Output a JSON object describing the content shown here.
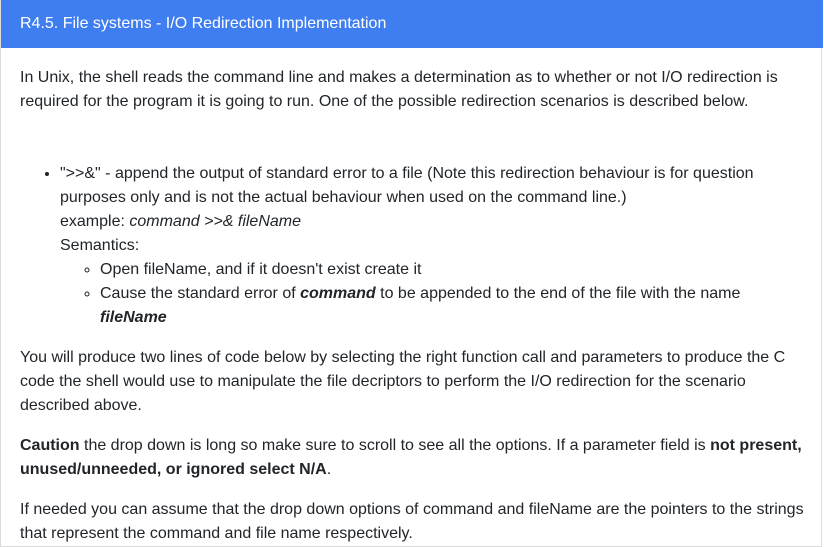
{
  "header": {
    "title": "R4.5. File systems - I/O Redirection Implementation"
  },
  "content": {
    "intro": "In Unix, the shell reads the command line and makes a determination as to whether or not I/O redirection is required for the program it is going to run. One of the possible redirection scenarios is described below.",
    "bullet": {
      "text": "\">>&\" - append the output of standard error to a file (Note this redirection behaviour is for question purposes only and is not the actual behaviour when used on the command line.)",
      "example_label": "example: ",
      "example_value": "command >>& fileName",
      "semantics_label": "Semantics:",
      "sub1": "Open fileName, and if it doesn't exist create it",
      "sub2_pre": "Cause the standard error of ",
      "sub2_cmd": "command",
      "sub2_mid": " to be appended to the end of the file with the name ",
      "sub2_file": "fileName"
    },
    "para2": "You will produce two lines of code below by selecting the right function call and parameters to produce the C code the shell would use to manipulate the file decriptors to perform the I/O redirection for the scenario described above.",
    "caution_label": "Caution",
    "caution_text": " the drop down is long so make sure to scroll to see all the options. If a parameter field is ",
    "caution_bold": "not present, unused/unneeded, or ignored select N/A",
    "caution_end": ".",
    "para4": "If needed you can assume that the drop down options of command and fileName are the pointers to the strings that represent the command and file name respectively."
  }
}
